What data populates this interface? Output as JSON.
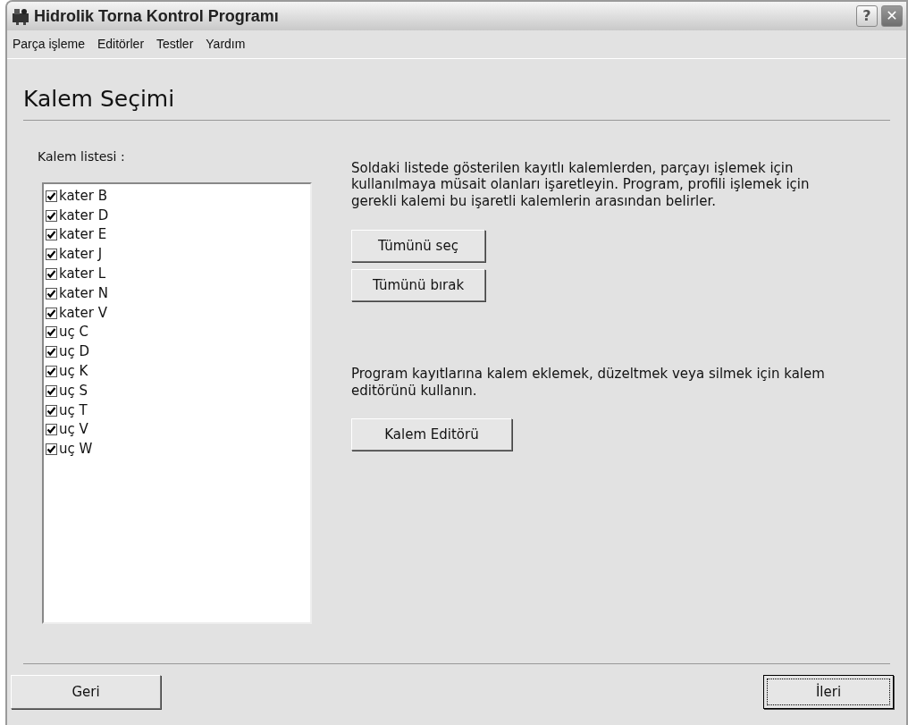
{
  "window": {
    "title": "Hidrolik Torna Kontrol Programı",
    "buttons": [
      {
        "kind": "help",
        "label": "?"
      },
      {
        "kind": "close",
        "label": "✕"
      }
    ]
  },
  "menu": [
    "Parça işleme",
    "Editörler",
    "Testler",
    "Yardım"
  ],
  "heading": "Kalem Seçimi",
  "list_label": "Kalem listesi :",
  "items": [
    {
      "label": "kater B",
      "checked": true
    },
    {
      "label": "kater D",
      "checked": true
    },
    {
      "label": "kater E",
      "checked": true
    },
    {
      "label": "kater J",
      "checked": true
    },
    {
      "label": "kater L",
      "checked": true
    },
    {
      "label": "kater N",
      "checked": true
    },
    {
      "label": "kater V",
      "checked": true
    },
    {
      "label": "uç C",
      "checked": true
    },
    {
      "label": "uç D",
      "checked": true
    },
    {
      "label": "uç K",
      "checked": true
    },
    {
      "label": "uç S",
      "checked": true
    },
    {
      "label": "uç T",
      "checked": true
    },
    {
      "label": "uç V",
      "checked": true
    },
    {
      "label": "uç W",
      "checked": true
    }
  ],
  "instructions": "Soldaki listede gösterilen kayıtlı kalemlerden, parçayı işlemek için kullanılmaya müsait olanları işaretleyin. Program, profili işlemek için gerekli kalemi bu işaretli kalemlerin arasından belirler.",
  "select_buttons": [
    "Tümünü seç",
    "Tümünü bırak"
  ],
  "editor_text": "Program kayıtlarına kalem eklemek, düzeltmek veya silmek için kalem editörünü kullanın.",
  "editor_button": "Kalem Editörü",
  "footer_buttons": [
    {
      "label": "Geri",
      "default": false
    },
    {
      "label": "İleri",
      "default": true
    }
  ]
}
